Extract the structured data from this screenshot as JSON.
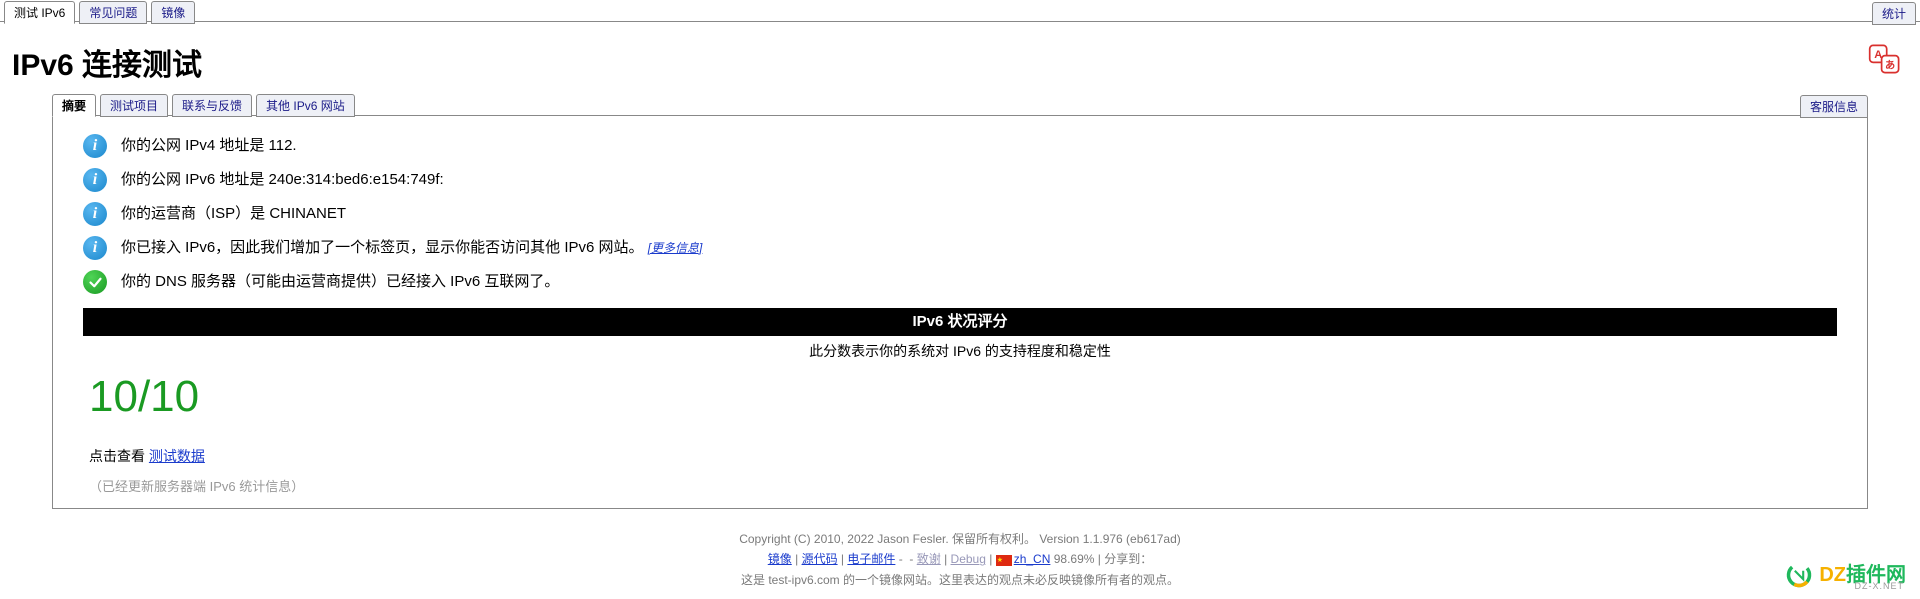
{
  "topTabs": {
    "items": [
      "测试 IPv6",
      "常见问题",
      "镜像"
    ],
    "right": "统计"
  },
  "pageTitle": "IPv6 连接测试",
  "innerTabs": {
    "items": [
      "摘要",
      "测试项目",
      "联系与反馈",
      "其他 IPv6 网站"
    ],
    "right": "客服信息"
  },
  "results": {
    "rows": [
      {
        "icon": "info",
        "text": "你的公网 IPv4 地址是 112."
      },
      {
        "icon": "info",
        "text": "你的公网 IPv6 地址是 240e:314:bed6:e154:749f:"
      },
      {
        "icon": "info",
        "text": "你的运营商（ISP）是 CHINANET"
      },
      {
        "icon": "info",
        "text": "你已接入 IPv6，因此我们增加了一个标签页，显示你能否访问其他 IPv6 网站。",
        "moreLink": "[更多信息]"
      },
      {
        "icon": "check",
        "text": "你的 DNS 服务器（可能由运营商提供）已经接入 IPv6 互联网了。"
      }
    ]
  },
  "score": {
    "header": "IPv6 状况评分",
    "desc": "此分数表示你的系统对 IPv6 的支持程度和稳定性",
    "value": "10/10"
  },
  "testDataPrefix": "点击查看 ",
  "testDataLink": "测试数据",
  "statsUpdated": "（已经更新服务器端 IPv6 统计信息）",
  "footer": {
    "copyright": "Copyright (C) 2010, 2022 Jason Fesler. 保留所有权利。 Version 1.1.976 (eb617ad)",
    "links": {
      "mirror": "镜像",
      "source": "源代码",
      "email": "电子邮件",
      "thanks": "致谢",
      "debug": "Debug",
      "locale": "zh_CN"
    },
    "percent": "98.69%",
    "shareLabel": "分享到：",
    "mirrorNote": "这是 test-ipv6.com 的一个镜像网站。这里表达的观点未必反映镜像所有者的观点。"
  },
  "watermark": {
    "brand1": "DZ",
    "brand2": "插件网",
    "sub": "DZ-X.NET"
  }
}
